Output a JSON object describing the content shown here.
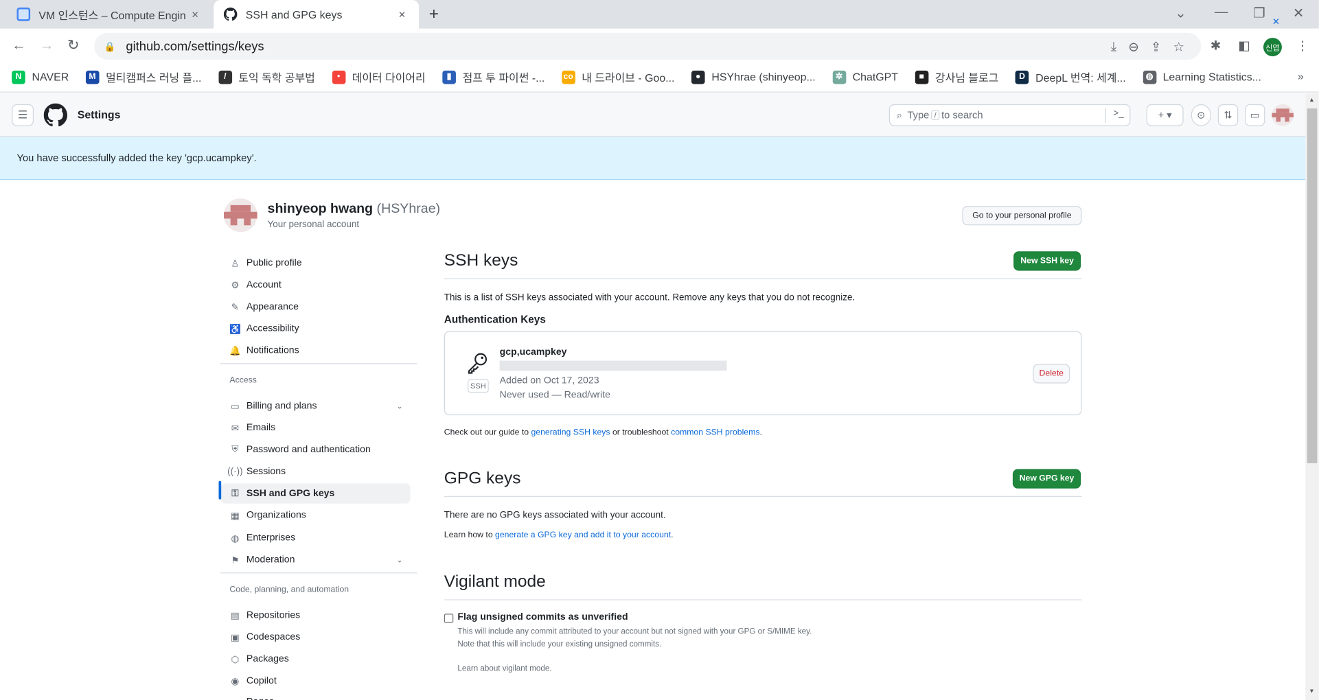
{
  "browser": {
    "tabs": [
      {
        "title": "VM 인스턴스 – Compute Engin",
        "close": "×"
      },
      {
        "title": "SSH and GPG keys",
        "close": "×"
      }
    ],
    "new_tab": "+",
    "url": "github.com/settings/keys",
    "profile_initials": "신엽",
    "bookmarks": [
      {
        "label": "NAVER",
        "color": "#03c75a",
        "glyph": "N"
      },
      {
        "label": "멀티캠퍼스 러닝 플...",
        "color": "#1a4aa8",
        "glyph": "M"
      },
      {
        "label": "토익 독학 공부법",
        "color": "#333333",
        "glyph": "/"
      },
      {
        "label": "데이터 다이어리",
        "color": "#f4433a",
        "glyph": "•"
      },
      {
        "label": "점프 투 파이썬 -...",
        "color": "#2b5fb7",
        "glyph": "▮"
      },
      {
        "label": "내 드라이브 - Goo...",
        "color": "#f9ab00",
        "glyph": "co"
      },
      {
        "label": "HSYhrae (shinyeop...",
        "color": "#24292f",
        "glyph": "●"
      },
      {
        "label": "ChatGPT",
        "color": "#74aa9c",
        "glyph": "✲"
      },
      {
        "label": "강사님 블로그",
        "color": "#222222",
        "glyph": "■"
      },
      {
        "label": "DeepL 번역: 세계...",
        "color": "#0f2b46",
        "glyph": "D"
      },
      {
        "label": "Learning Statistics...",
        "color": "#5f6368",
        "glyph": "◍"
      }
    ],
    "bookmarks_more": "»"
  },
  "header": {
    "title": "Settings",
    "search_pre": "Type",
    "search_key": "/",
    "search_post": "to search",
    "command_glyph": ">_",
    "plus_glyph": "+ ▾"
  },
  "flash": {
    "message": "You have successfully added the key 'gcp.ucampkey'.",
    "close": "×"
  },
  "profile": {
    "name": "shinyeop hwang",
    "login": "(HSYhrae)",
    "subtitle": "Your personal account",
    "go_profile_label": "Go to your personal profile"
  },
  "sidebar": {
    "items_top": [
      {
        "label": "Public profile",
        "icon": "person-icon",
        "glyph": "♙"
      },
      {
        "label": "Account",
        "icon": "gear-icon",
        "glyph": "⚙"
      },
      {
        "label": "Appearance",
        "icon": "paintbrush-icon",
        "glyph": "✎"
      },
      {
        "label": "Accessibility",
        "icon": "accessibility-icon",
        "glyph": "♿"
      },
      {
        "label": "Notifications",
        "icon": "bell-icon",
        "glyph": "🔔"
      }
    ],
    "access_heading": "Access",
    "items_access": [
      {
        "label": "Billing and plans",
        "icon": "credit-card-icon",
        "glyph": "▭",
        "chevron": true
      },
      {
        "label": "Emails",
        "icon": "mail-icon",
        "glyph": "✉"
      },
      {
        "label": "Password and authentication",
        "icon": "shield-lock-icon",
        "glyph": "⛨"
      },
      {
        "label": "Sessions",
        "icon": "broadcast-icon",
        "glyph": "((·))"
      },
      {
        "label": "SSH and GPG keys",
        "icon": "key-icon",
        "glyph": "⚿",
        "active": true
      },
      {
        "label": "Organizations",
        "icon": "organization-icon",
        "glyph": "▦"
      },
      {
        "label": "Enterprises",
        "icon": "globe-icon",
        "glyph": "◍"
      },
      {
        "label": "Moderation",
        "icon": "report-icon",
        "glyph": "⚑",
        "chevron": true
      }
    ],
    "code_heading": "Code, planning, and automation",
    "items_code": [
      {
        "label": "Repositories",
        "icon": "repo-icon",
        "glyph": "▤"
      },
      {
        "label": "Codespaces",
        "icon": "codespaces-icon",
        "glyph": "▣"
      },
      {
        "label": "Packages",
        "icon": "package-icon",
        "glyph": "⬡"
      },
      {
        "label": "Copilot",
        "icon": "copilot-icon",
        "glyph": "◉"
      },
      {
        "label": "Pages",
        "icon": "browser-icon",
        "glyph": "▭"
      }
    ]
  },
  "ssh": {
    "title": "SSH keys",
    "new_button": "New SSH key",
    "description": "This is a list of SSH keys associated with your account. Remove any keys that you do not recognize.",
    "auth_heading": "Authentication Keys",
    "key": {
      "title": "gcp,ucampkey",
      "type": "SSH",
      "added": "Added on Oct 17, 2023",
      "usage": "Never used — Read/write",
      "delete_label": "Delete"
    },
    "guide_pre": "Check out our guide to ",
    "guide_link1": "generating SSH keys",
    "guide_mid": " or troubleshoot ",
    "guide_link2": "common SSH problems",
    "guide_post": "."
  },
  "gpg": {
    "title": "GPG keys",
    "new_button": "New GPG key",
    "empty": "There are no GPG keys associated with your account.",
    "learn_pre": "Learn how to ",
    "learn_link": "generate a GPG key and add it to your account",
    "learn_post": "."
  },
  "vigilant": {
    "title": "Vigilant mode",
    "checkbox_label": "Flag unsigned commits as unverified",
    "checked": false,
    "note1": "This will include any commit attributed to your account but not signed with your GPG or S/MIME key.",
    "note2": "Note that this will include your existing unsigned commits.",
    "learn_link": "Learn about vigilant mode."
  }
}
